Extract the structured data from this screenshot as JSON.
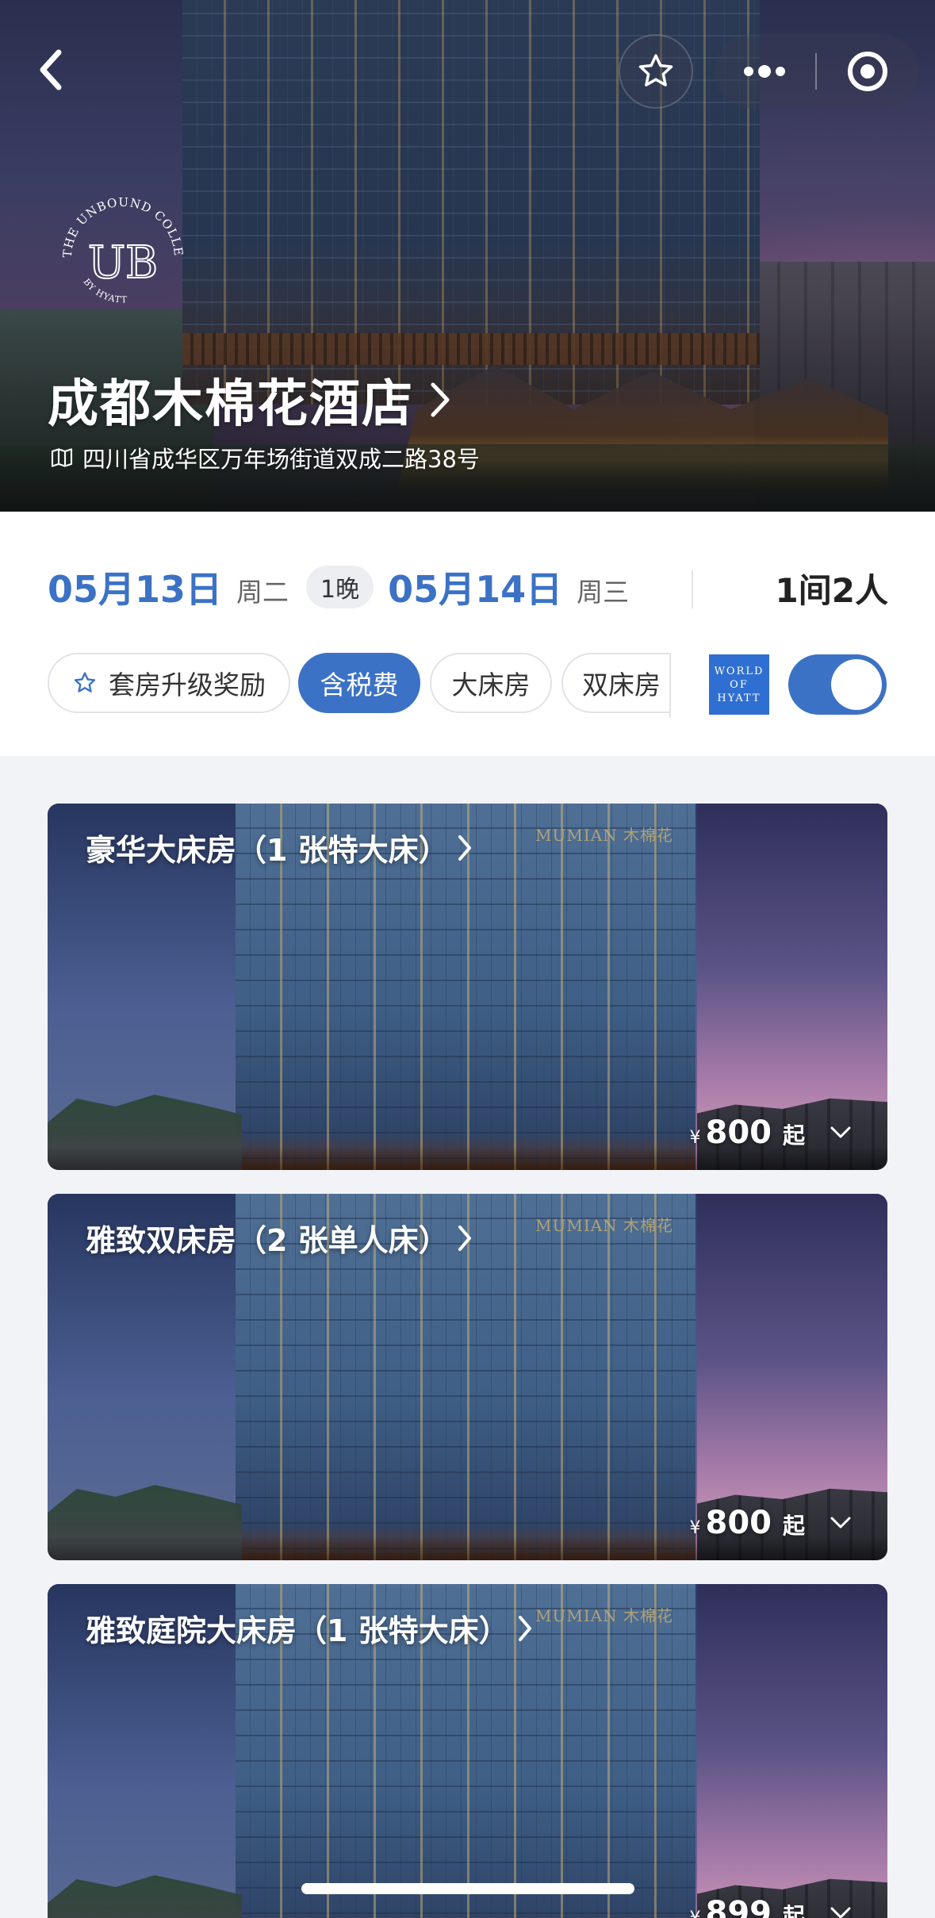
{
  "hero": {
    "hotel_name": "成都木棉花酒店",
    "address": "四川省成华区万年场街道双成二路38号",
    "brand_logo_text": "THE UNBOUND COLLECTION BY HYATT"
  },
  "stay": {
    "checkin_date": "05月13日",
    "checkin_weekday": "周二",
    "nights": "1晚",
    "checkout_date": "05月14日",
    "checkout_weekday": "周三",
    "rooms_guests": "1间2人"
  },
  "filters": [
    {
      "label": "套房升级奖励",
      "active": false,
      "icon": "star-outline-icon"
    },
    {
      "label": "含税费",
      "active": true
    },
    {
      "label": "大床房",
      "active": false
    },
    {
      "label": "双床房",
      "active": false
    }
  ],
  "world_of_hyatt": {
    "line1": "WORLD",
    "line2": "OF",
    "line3": "HYATT",
    "toggle_on": true
  },
  "rooms": [
    {
      "name": "豪华大床房（1 张特大床）",
      "currency": "¥",
      "price": "800",
      "suffix": "起",
      "sign": "MUMIAN 木棉花"
    },
    {
      "name": "雅致双床房（2 张单人床）",
      "currency": "¥",
      "price": "800",
      "suffix": "起",
      "sign": "MUMIAN 木棉花"
    },
    {
      "name": "雅致庭院大床房（1 张特大床）",
      "currency": "¥",
      "price": "899",
      "suffix": "起",
      "sign": "MUMIAN 木棉花"
    }
  ],
  "colors": {
    "accent": "#3b72c5",
    "hyatt_blue": "#2f6fd1",
    "background": "#f2f3f7"
  }
}
